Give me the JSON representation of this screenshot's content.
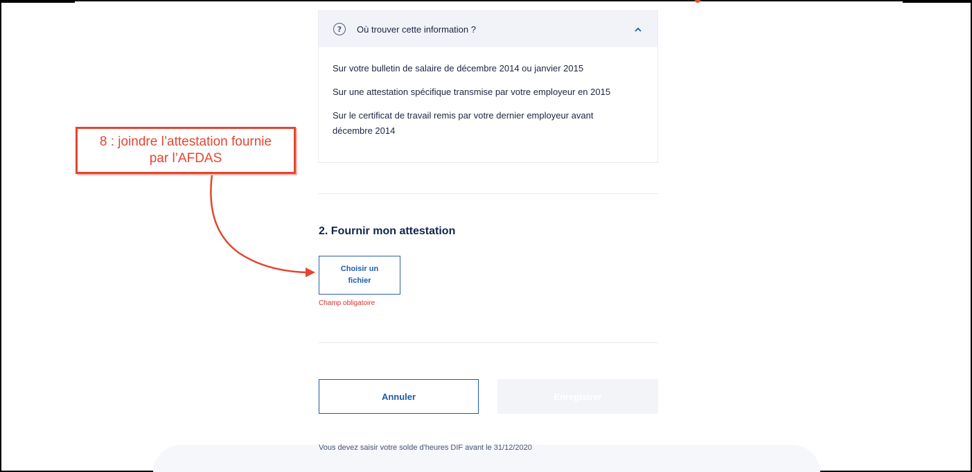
{
  "accordion": {
    "title": "Où trouver cette information ?",
    "icon": "question-circle-icon",
    "chevron_icon": "chevron-up-icon",
    "lines": [
      "Sur votre bulletin de salaire de décembre 2014 ou janvier 2015",
      "Sur une attestation spécifique transmise par votre employeur en 2015",
      "Sur le certificat de travail remis par votre dernier employeur avant décembre 2014"
    ]
  },
  "section": {
    "title": "2. Fournir mon attestation",
    "file_button": "Choisir un fichier",
    "required_message": "Champ obligatoire"
  },
  "actions": {
    "cancel": "Annuler",
    "save": "Enregistrer"
  },
  "footer": {
    "deadline": "Vous devez saisir votre solde d'heures DIF avant le 31/12/2020"
  },
  "annotation": {
    "line1": "8 : joindre l’attestation fournie",
    "line2": "par l’AFDAS"
  },
  "colors": {
    "primary": "#1e5aa8",
    "error": "#d6322d",
    "annotation": "#e3452f",
    "heading": "#122450"
  }
}
